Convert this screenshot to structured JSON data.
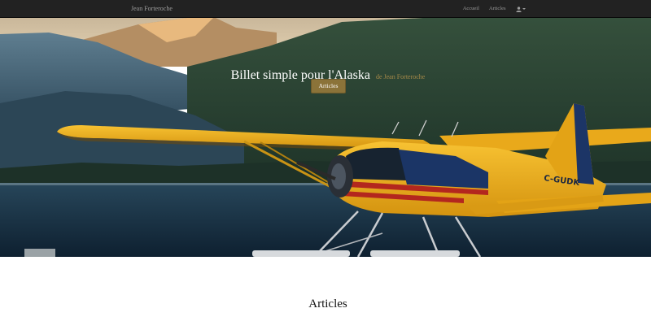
{
  "navbar": {
    "brand": "Jean Forteroche",
    "links": [
      "Accueil",
      "Articles"
    ],
    "user_menu_icon": "user-icon"
  },
  "hero": {
    "title": "Billet simple pour l'Alaska",
    "subtitle": "de Jean Forteroche",
    "button_label": "Articles",
    "aircraft_registration": "C-GUDK"
  },
  "articles_section": {
    "title": "Articles"
  },
  "colors": {
    "navbar_bg": "#222222",
    "nav_text": "#9d9d9d",
    "accent": "#8b7339",
    "subtitle": "#a78a49",
    "plane_yellow": "#f2b51a"
  }
}
